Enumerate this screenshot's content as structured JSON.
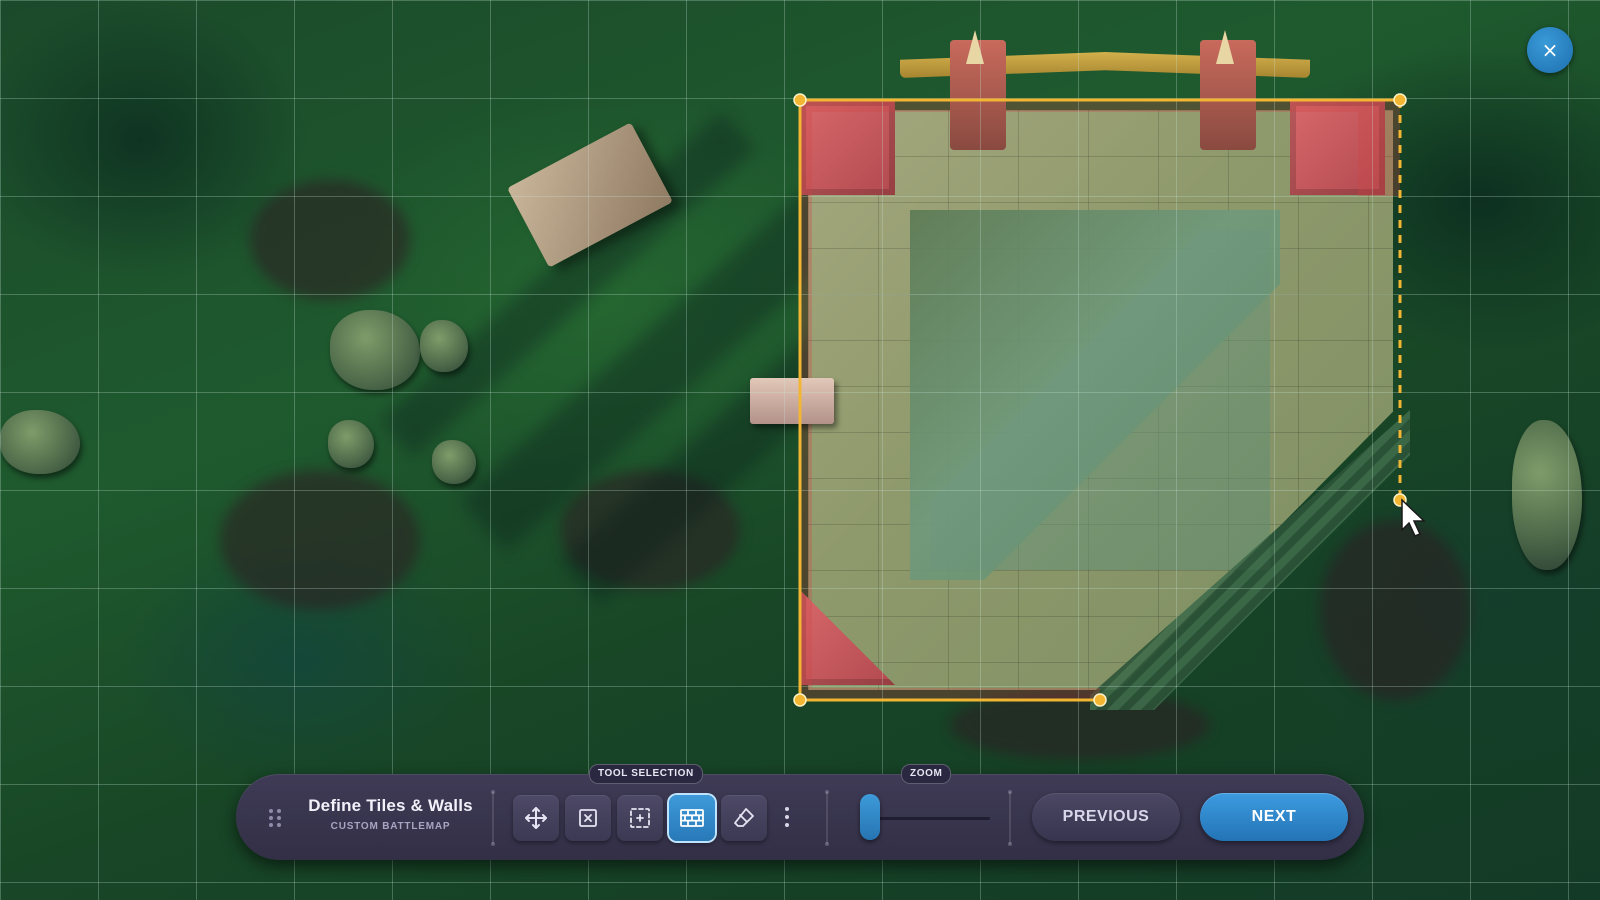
{
  "window": {
    "close_label": "×"
  },
  "toolbar": {
    "title": "Define Tiles & Walls",
    "subtitle": "CUSTOM BATTLEMAP",
    "tool_selection_label": "TOOL SELECTION",
    "zoom_label": "ZOOM",
    "zoom_level": 0.05,
    "active_tool": "tiles-walls",
    "tools": [
      {
        "name": "move-tool",
        "icon": "move-arrows-icon",
        "active": false
      },
      {
        "name": "delete-tile-tool",
        "icon": "box-x-icon",
        "active": false
      },
      {
        "name": "select-area-tool",
        "icon": "dashed-select-icon",
        "active": false
      },
      {
        "name": "tiles-walls-tool",
        "icon": "brick-wall-icon",
        "active": true
      },
      {
        "name": "eraser-tool",
        "icon": "eraser-icon",
        "active": false
      }
    ],
    "previous_label": "PREVIOUS",
    "next_label": "NEXT"
  },
  "colors": {
    "accent": "#2f86c9",
    "selection": "#f2b632",
    "toolbar_bg": "#38344e"
  }
}
